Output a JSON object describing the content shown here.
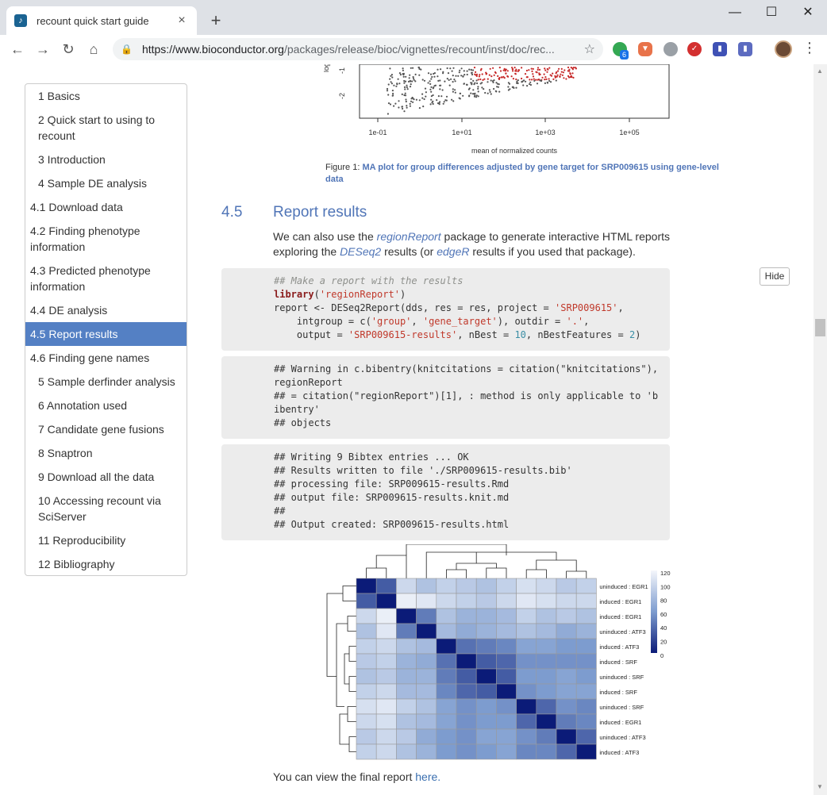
{
  "browser": {
    "tab_title": "recount quick start guide",
    "tab_close": "×",
    "new_tab": "+",
    "url_host": "https://www.bioconductor.org",
    "url_path": "/packages/release/bioc/vignettes/recount/inst/doc/rec...",
    "ext_badge": "6",
    "minimize": "—",
    "maximize": "☐",
    "close": "✕"
  },
  "toc": [
    {
      "label": "1 Basics",
      "level": 1
    },
    {
      "label": "2 Quick start to using to recount",
      "level": 1
    },
    {
      "label": "3 Introduction",
      "level": 1
    },
    {
      "label": "4 Sample DE analysis",
      "level": 1
    },
    {
      "label": "4.1 Download data",
      "level": 2
    },
    {
      "label": "4.2 Finding phenotype information",
      "level": 2
    },
    {
      "label": "4.3 Predicted phenotype information",
      "level": 2
    },
    {
      "label": "4.4 DE analysis",
      "level": 2
    },
    {
      "label": "4.5 Report results",
      "level": 2,
      "active": true
    },
    {
      "label": "4.6 Finding gene names",
      "level": 2
    },
    {
      "label": "5 Sample derfinder analysis",
      "level": 1
    },
    {
      "label": "6 Annotation used",
      "level": 1
    },
    {
      "label": "7 Candidate gene fusions",
      "level": 1
    },
    {
      "label": "8 Snaptron",
      "level": 1
    },
    {
      "label": "9 Download all the data",
      "level": 1
    },
    {
      "label": "10 Accessing recount via SciServer",
      "level": 1
    },
    {
      "label": "11 Reproducibility",
      "level": 1
    },
    {
      "label": "12 Bibliography",
      "level": 1
    }
  ],
  "ma_plot": {
    "y_label": "log",
    "y_ticks": [
      "-1",
      "-2"
    ],
    "x_ticks": [
      "1e-01",
      "1e+01",
      "1e+03",
      "1e+05"
    ],
    "x_label": "mean of normalized counts"
  },
  "figure": {
    "prefix": "Figure 1: ",
    "caption": "MA plot for group differences adjusted by gene target for SRP009615 using gene-level data"
  },
  "section": {
    "number": "4.5",
    "title": "Report results"
  },
  "paragraph": {
    "t1": "We can also use the ",
    "link1": "regionReport",
    "t2": " package to generate interactive HTML reports exploring the ",
    "link2": "DESeq2",
    "t3": " results (or ",
    "link3": "edgeR",
    "t4": " results if you used that package)."
  },
  "code_block": {
    "comment": "## Make a report with the results",
    "l2_kw": "library",
    "l2_open": "(",
    "l2_str": "'regionReport'",
    "l2_close": ")",
    "l3a": "report <- DESeq2Report(dds, res = res, project = ",
    "l3_str": "'SRP009615'",
    "l3b": ",",
    "l4a": "    intgroup = c(",
    "l4_s1": "'group'",
    "l4b": ", ",
    "l4_s2": "'gene_target'",
    "l4c": "), outdir = ",
    "l4_s3": "'.'",
    "l4d": ",",
    "l5a": "    output = ",
    "l5_str": "'SRP009615-results'",
    "l5b": ", nBest = ",
    "l5_n1": "10",
    "l5c": ", nBestFeatures = ",
    "l5_n2": "2",
    "l5d": ")"
  },
  "output1": "## Warning in c.bibentry(knitcitations = citation(\"knitcitations\"),\nregionReport\n## = citation(\"regionReport\")[1], : method is only applicable to 'b\nibentry'\n## objects",
  "output2": "## Writing 9 Bibtex entries ... OK\n## Results written to file './SRP009615-results.bib'\n## processing file: SRP009615-results.Rmd\n## output file: SRP009615-results.knit.md\n##\n## Output created: SRP009615-results.html",
  "hide_button": "Hide",
  "heatmap": {
    "row_labels": [
      "uninduced : EGR1",
      "induced : EGR1",
      "induced : EGR1",
      "uninduced : ATF3",
      "induced : ATF3",
      "induced : SRF",
      "uninduced : SRF",
      "induced : SRF",
      "uninduced : SRF",
      "induced : EGR1",
      "uninduced : ATF3",
      "induced : ATF3"
    ],
    "legend_ticks": [
      "120",
      "100",
      "80",
      "60",
      "40",
      "20",
      "0"
    ],
    "values": [
      [
        0,
        30,
        100,
        85,
        95,
        90,
        85,
        95,
        105,
        100,
        90,
        95
      ],
      [
        30,
        0,
        115,
        110,
        100,
        95,
        90,
        100,
        110,
        105,
        100,
        100
      ],
      [
        100,
        115,
        0,
        45,
        85,
        75,
        75,
        80,
        95,
        85,
        90,
        85
      ],
      [
        85,
        110,
        45,
        0,
        80,
        70,
        75,
        80,
        85,
        80,
        70,
        75
      ],
      [
        95,
        100,
        85,
        80,
        0,
        40,
        45,
        50,
        65,
        65,
        60,
        60
      ],
      [
        90,
        95,
        75,
        70,
        40,
        0,
        30,
        35,
        55,
        55,
        55,
        55
      ],
      [
        85,
        90,
        75,
        75,
        45,
        30,
        0,
        30,
        60,
        60,
        65,
        60
      ],
      [
        95,
        100,
        80,
        80,
        50,
        35,
        30,
        0,
        55,
        60,
        65,
        65
      ],
      [
        105,
        110,
        95,
        85,
        65,
        55,
        60,
        55,
        0,
        35,
        55,
        50
      ],
      [
        100,
        105,
        85,
        80,
        65,
        55,
        60,
        60,
        35,
        0,
        45,
        50
      ],
      [
        90,
        100,
        90,
        70,
        60,
        55,
        65,
        65,
        55,
        45,
        0,
        35
      ],
      [
        95,
        100,
        85,
        75,
        60,
        55,
        60,
        65,
        50,
        50,
        35,
        0
      ]
    ]
  },
  "final": {
    "text": "You can view the final report ",
    "link": "here."
  }
}
